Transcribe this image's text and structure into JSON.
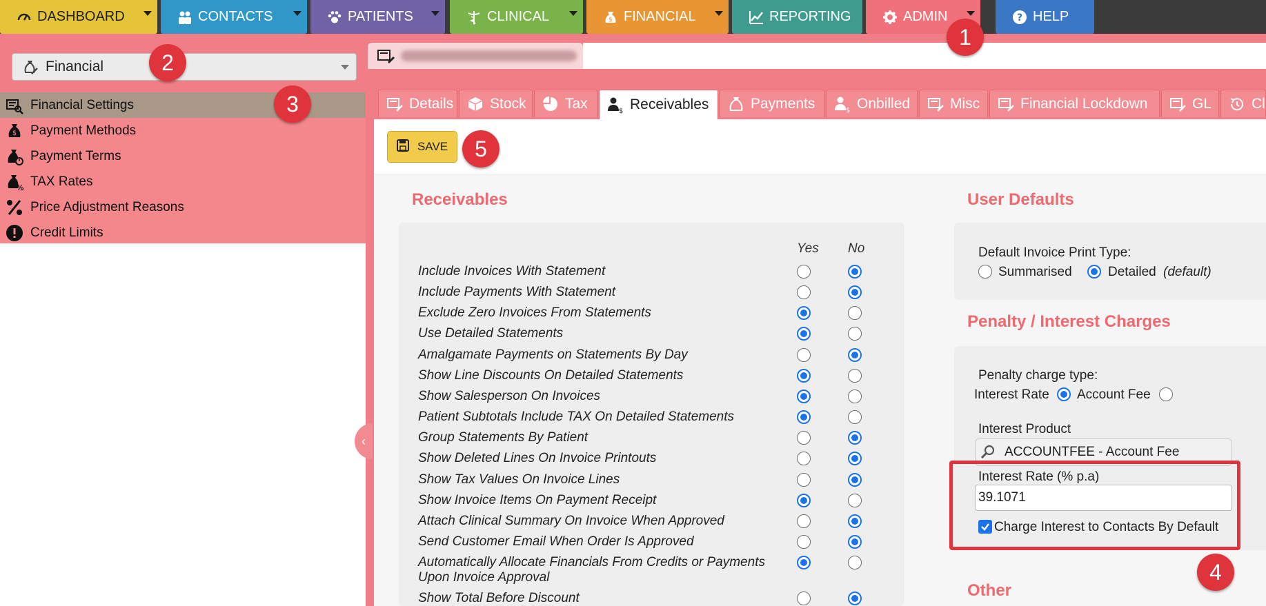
{
  "nav": {
    "dashboard": "DASHBOARD",
    "contacts": "CONTACTS",
    "patients": "PATIENTS",
    "clinical": "CLINICAL",
    "financial": "FINANCIAL",
    "reporting": "REPORTING",
    "admin": "ADMIN",
    "help": "HELP"
  },
  "module_select": {
    "value": "Financial"
  },
  "sidebar": {
    "items": [
      {
        "label": "Financial Settings",
        "icon": "financial-settings-icon",
        "active": true
      },
      {
        "label": "Payment Methods",
        "icon": "money-bag-icon"
      },
      {
        "label": "Payment Terms",
        "icon": "money-bag-clock-icon"
      },
      {
        "label": "TAX Rates",
        "icon": "money-bag-percent-icon"
      },
      {
        "label": "Price Adjustment Reasons",
        "icon": "percent-icon"
      },
      {
        "label": "Credit Limits",
        "icon": "exclamation-icon"
      }
    ]
  },
  "subtabs": [
    {
      "label": "Details"
    },
    {
      "label": "Stock"
    },
    {
      "label": "Tax"
    },
    {
      "label": "Receivables",
      "active": true
    },
    {
      "label": "Payments"
    },
    {
      "label": "Onbilled"
    },
    {
      "label": "Misc"
    },
    {
      "label": "Financial Lockdown"
    },
    {
      "label": "GL"
    },
    {
      "label": "Cl"
    }
  ],
  "toolbar": {
    "save_label": "SAVE"
  },
  "receivables": {
    "title": "Receivables",
    "yes_label": "Yes",
    "no_label": "No",
    "options": [
      {
        "label": "Include Invoices With Statement",
        "value": "no"
      },
      {
        "label": "Include Payments With Statement",
        "value": "no"
      },
      {
        "label": "Exclude Zero Invoices From Statements",
        "value": "yes"
      },
      {
        "label": "Use Detailed Statements",
        "value": "yes"
      },
      {
        "label": "Amalgamate Payments on Statements By Day",
        "value": "no"
      },
      {
        "label": "Show Line Discounts On Detailed Statements",
        "value": "yes"
      },
      {
        "label": "Show Salesperson On Invoices",
        "value": "yes"
      },
      {
        "label": "Patient Subtotals Include TAX On Detailed Statements",
        "value": "yes"
      },
      {
        "label": "Group Statements By Patient",
        "value": "no"
      },
      {
        "label": "Show Deleted Lines On Invoice Printouts",
        "value": "no"
      },
      {
        "label": "Show Tax Values On Invoice Lines",
        "value": "no"
      },
      {
        "label": "Show Invoice Items On Payment Receipt",
        "value": "yes"
      },
      {
        "label": "Attach Clinical Summary On Invoice When Approved",
        "value": "no"
      },
      {
        "label": "Send Customer Email When Order Is Approved",
        "value": "no"
      },
      {
        "label": "Automatically Allocate Financials From Credits or Payments",
        "label2": "Upon Invoice Approval",
        "value": "yes"
      },
      {
        "label": "Show Total Before Discount",
        "value": "no"
      }
    ]
  },
  "user_defaults": {
    "title": "User Defaults",
    "print_type_label": "Default Invoice Print Type:",
    "summarised_label": "Summarised",
    "detailed_label": "Detailed",
    "detailed_suffix": "(default)",
    "selected": "detailed"
  },
  "penalty": {
    "title": "Penalty / Interest Charges",
    "charge_type_label": "Penalty charge type:",
    "interest_rate_option": "Interest Rate",
    "account_fee_option": "Account Fee",
    "selected": "interest_rate",
    "product_label": "Interest Product",
    "product_value": "ACCOUNTFEE - Account Fee",
    "rate_label": "Interest Rate (% p.a)",
    "rate_value": "39.1071",
    "charge_default_label": "Charge Interest to Contacts By Default",
    "charge_default_checked": true
  },
  "other": {
    "title": "Other"
  },
  "annotations": {
    "b1": "1",
    "b2": "2",
    "b3": "3",
    "b4": "4",
    "b5": "5"
  },
  "colors": {
    "accent": "#ee6a6f",
    "band": "#f17e86",
    "radio_selected": "#1a73e8",
    "highlight": "#e0343c"
  }
}
